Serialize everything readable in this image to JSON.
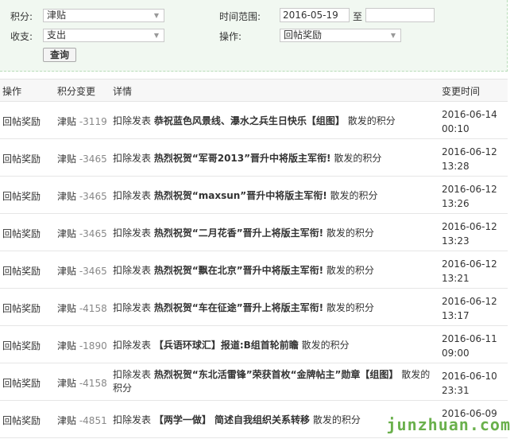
{
  "filter": {
    "credit_label": "积分:",
    "credit_value": "津贴",
    "type_label": "收支:",
    "type_value": "支出",
    "time_label": "时间范围:",
    "date_from": "2016-05-19",
    "to_label": "至",
    "date_to": "",
    "op_label": "操作:",
    "op_value": "回帖奖励",
    "query_button": "查询"
  },
  "table": {
    "headers": [
      "操作",
      "积分变更",
      "详情",
      "变更时间"
    ],
    "rows": [
      {
        "op": "回帖奖励",
        "credit": "津贴",
        "amount": "-3119",
        "prefix": "扣除发表",
        "title": "恭祝蓝色风景线、瀑水之兵生日快乐【组图】",
        "suffix": "散发的积分",
        "date": "2016-06-14",
        "time": "00:10"
      },
      {
        "op": "回帖奖励",
        "credit": "津贴",
        "amount": "-3465",
        "prefix": "扣除发表",
        "title": "热烈祝贺“军哥2013”晋升中将版主军衔!",
        "suffix": "散发的积分",
        "date": "2016-06-12",
        "time": "13:28"
      },
      {
        "op": "回帖奖励",
        "credit": "津贴",
        "amount": "-3465",
        "prefix": "扣除发表",
        "title": "热烈祝贺“maxsun”晋升中将版主军衔!",
        "suffix": "散发的积分",
        "date": "2016-06-12",
        "time": "13:26"
      },
      {
        "op": "回帖奖励",
        "credit": "津贴",
        "amount": "-3465",
        "prefix": "扣除发表",
        "title": "热烈祝贺“二月花香”晋升上将版主军衔!",
        "suffix": "散发的积分",
        "date": "2016-06-12",
        "time": "13:23"
      },
      {
        "op": "回帖奖励",
        "credit": "津贴",
        "amount": "-3465",
        "prefix": "扣除发表",
        "title": "热烈祝贺“飘在北京”晋升中将版主军衔!",
        "suffix": "散发的积分",
        "date": "2016-06-12",
        "time": "13:21"
      },
      {
        "op": "回帖奖励",
        "credit": "津贴",
        "amount": "-4158",
        "prefix": "扣除发表",
        "title": "热烈祝贺“车在征途”晋升上将版主军衔!",
        "suffix": "散发的积分",
        "date": "2016-06-12",
        "time": "13:17"
      },
      {
        "op": "回帖奖励",
        "credit": "津贴",
        "amount": "-1890",
        "prefix": "扣除发表",
        "title": "【兵语环球汇】报道:B组首轮前瞻",
        "suffix": "散发的积分",
        "date": "2016-06-11",
        "time": "09:00"
      },
      {
        "op": "回帖奖励",
        "credit": "津贴",
        "amount": "-4158",
        "prefix": "扣除发表",
        "title": "热烈祝贺“东北活雷锋”荣获首枚“金牌帖主”勋章【组图】",
        "suffix": "散发的积分",
        "date": "2016-06-10",
        "time": "23:31"
      },
      {
        "op": "回帖奖励",
        "credit": "津贴",
        "amount": "-4851",
        "prefix": "扣除发表",
        "title": "【两学一做】 简述自我组织关系转移",
        "suffix": "散发的积分",
        "date": "2016-06-09",
        "time": ""
      }
    ]
  },
  "watermark": "junzhuan.com",
  "colors": {
    "accent_green": "#6ab04c",
    "filter_bg": "#f1f8f1"
  }
}
